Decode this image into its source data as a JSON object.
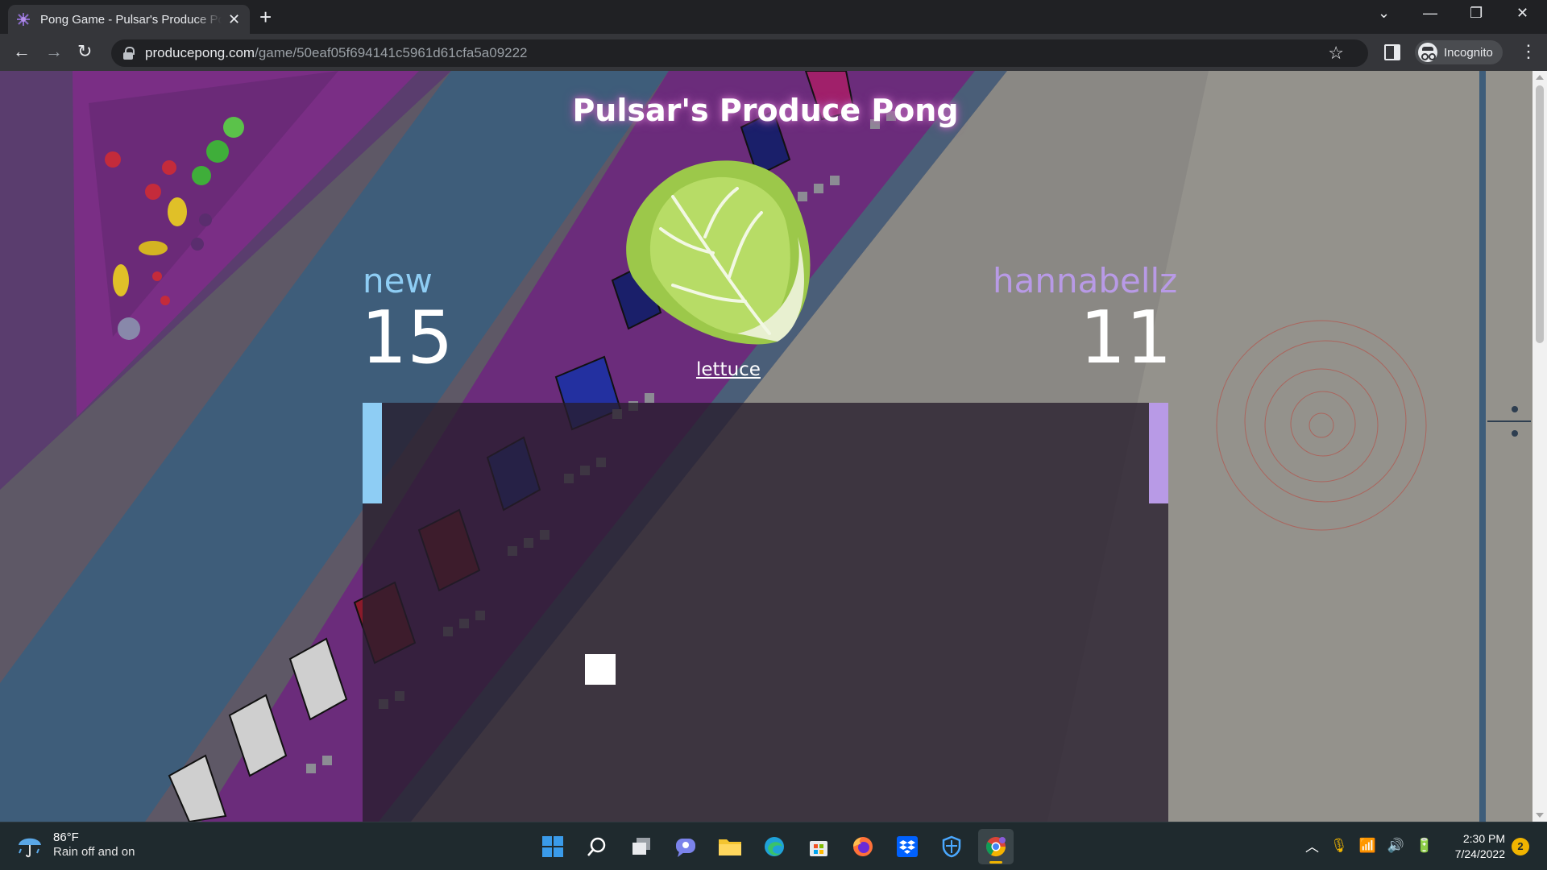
{
  "browser": {
    "tab_title": "Pong Game - Pulsar's Produce Pong",
    "url_host": "producepong.com",
    "url_path": "/game/50eaf05f694141c5961d61cfa5a09222",
    "profile_label": "Incognito"
  },
  "game": {
    "title": "Pulsar's Produce Pong",
    "player_left": {
      "name": "new",
      "score": "15",
      "color": "#8ecdf4"
    },
    "player_right": {
      "name": "hannabellz",
      "score": "11",
      "color": "#b89ae6"
    },
    "produce_name": "lettuce",
    "produce_icon": "lettuce-icon"
  },
  "taskbar": {
    "weather_temp": "86°F",
    "weather_desc": "Rain off and on",
    "time": "2:30 PM",
    "date": "7/24/2022",
    "notification_count": "2",
    "pinned": [
      "windows-start-icon",
      "search-icon",
      "task-view-icon",
      "chat-icon",
      "file-explorer-icon",
      "edge-icon",
      "store-icon",
      "firefox-icon",
      "dropbox-icon",
      "defender-icon",
      "chrome-icon"
    ]
  }
}
